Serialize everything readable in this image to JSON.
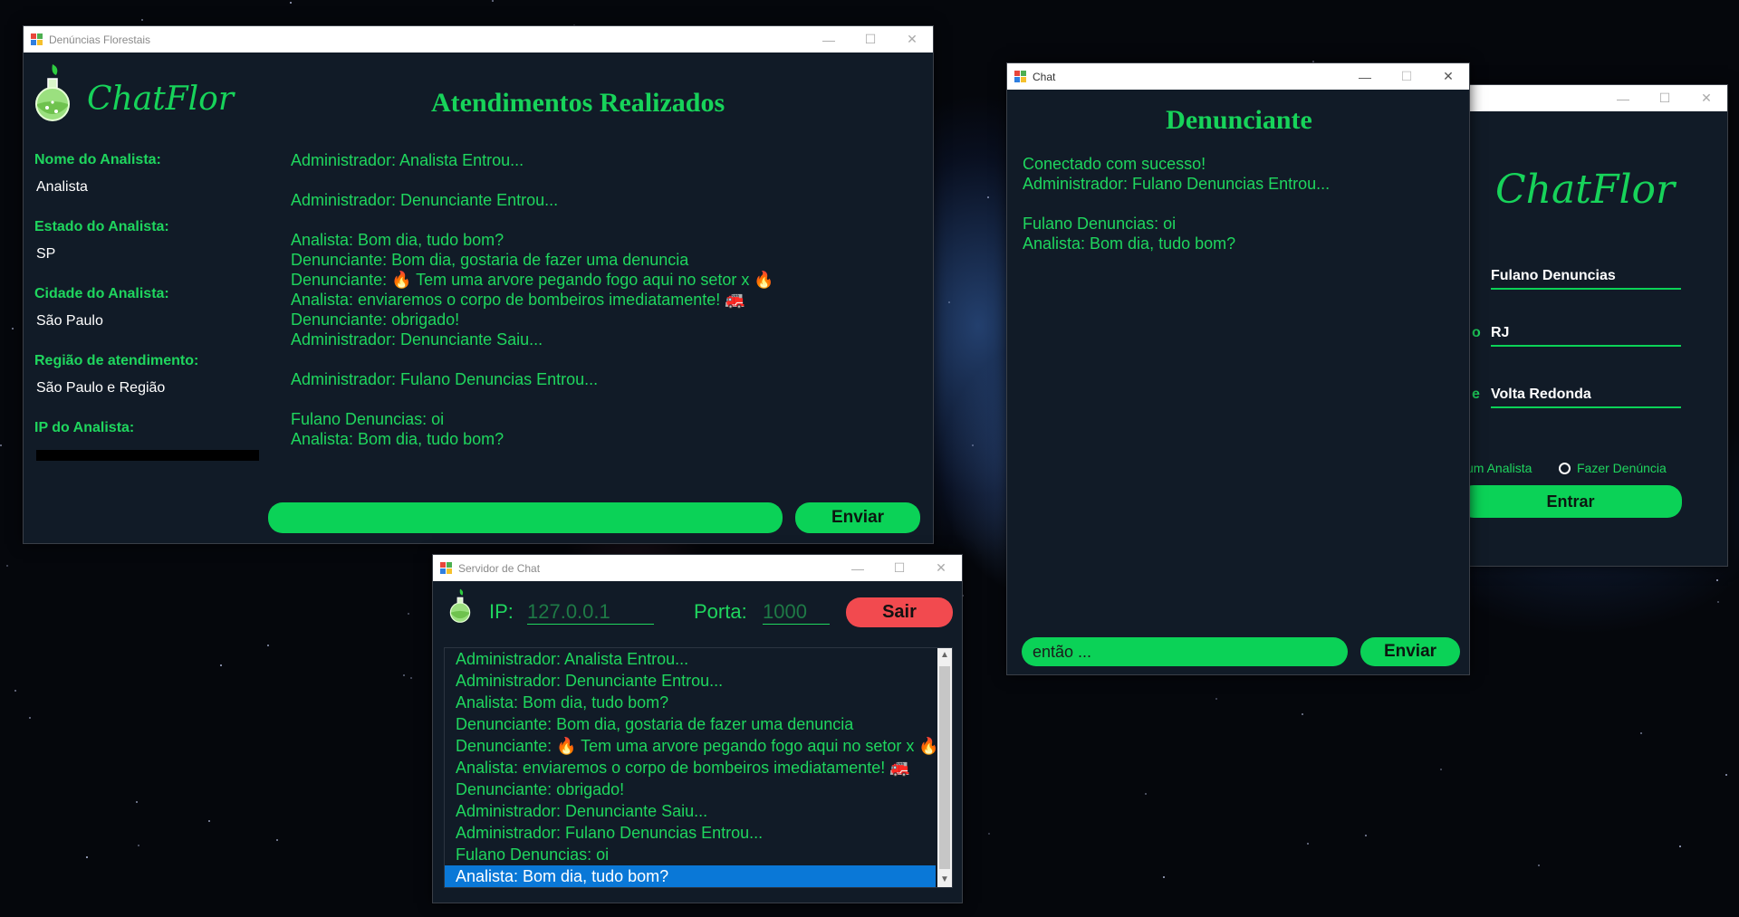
{
  "main_window": {
    "title": "Denúncias Florestais",
    "brand": "ChatFlor",
    "heading": "Atendimentos Realizados",
    "fields": [
      {
        "label": "Nome do Analista:",
        "value": "Analista"
      },
      {
        "label": "Estado do Analista:",
        "value": "SP"
      },
      {
        "label": "Cidade do Analista:",
        "value": "São Paulo"
      },
      {
        "label": "Região de atendimento:",
        "value": "São Paulo e Região"
      },
      {
        "label": "IP do Analista:",
        "value": ""
      }
    ],
    "messages": [
      "Administrador: Analista Entrou...",
      "",
      "Administrador: Denunciante Entrou...",
      "",
      "Analista: Bom dia, tudo bom?",
      "Denunciante: Bom dia, gostaria de fazer uma denuncia",
      "Denunciante: 🔥 Tem uma arvore pegando fogo aqui no setor x 🔥",
      "Analista: enviaremos o corpo de bombeiros imediatamente! 🚒",
      "Denunciante: obrigado!",
      "Administrador: Denunciante Saiu...",
      "",
      "Administrador: Fulano Denuncias Entrou...",
      "",
      "Fulano Denuncias: oi",
      "Analista: Bom dia, tudo bom?"
    ],
    "input_value": "",
    "send_label": "Enviar"
  },
  "chat_window": {
    "title": "Chat",
    "heading": "Denunciante",
    "messages": [
      "Conectado com sucesso!",
      "Administrador: Fulano Denuncias Entrou...",
      "",
      "Fulano Denuncias: oi",
      "Analista: Bom dia, tudo bom?"
    ],
    "input_value": "então ...",
    "send_label": "Enviar"
  },
  "login_window": {
    "brand": "ChatFlor",
    "name_value": "Fulano Denuncias",
    "state_label_partial": "o",
    "state_value": "RJ",
    "city_label_partial": "e",
    "city_value": "Volta Redonda",
    "radio_analyst_partial": "um Analista",
    "radio_report": "Fazer Denúncia",
    "enter_label": "Entrar"
  },
  "server_window": {
    "title": "Servidor de Chat",
    "ip_label": "IP:",
    "ip_value": "127.0.0.1",
    "port_label": "Porta:",
    "port_value": "1000",
    "exit_label": "Sair",
    "log": [
      "Administrador: Analista Entrou...",
      "Administrador: Denunciante Entrou...",
      "Analista: Bom dia, tudo bom?",
      "Denunciante: Bom dia, gostaria de fazer uma denuncia",
      "Denunciante: 🔥 Tem uma arvore pegando fogo aqui no setor x 🔥",
      "Analista: enviaremos o corpo de bombeiros imediatamente! 🚒",
      "Denunciante: obrigado!",
      "Administrador: Denunciante Saiu...",
      "Administrador: Fulano Denuncias Entrou...",
      "Fulano Denuncias: oi",
      "Analista: Bom dia, tudo bom?"
    ],
    "selected_index": 10
  },
  "colors": {
    "accent_green": "#0bd257",
    "text_green": "#1fd65e",
    "panel_bg": "#111b27",
    "exit_red": "#f24a4f",
    "selection_blue": "#0a78d7"
  }
}
